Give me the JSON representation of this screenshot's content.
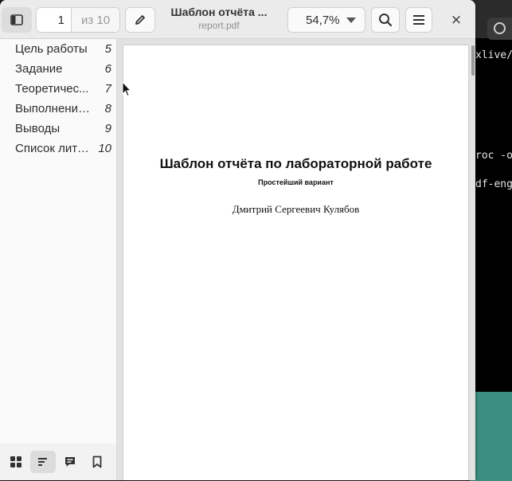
{
  "background_terminal": {
    "lines": [
      "xlive/",
      "roc -o",
      "df-eng"
    ]
  },
  "header": {
    "page_number": "1",
    "page_of": "из 10",
    "title": "Шаблон отчёта ...",
    "subtitle": "report.pdf",
    "zoom": "54,7%",
    "close_glyph": "×"
  },
  "sidebar": {
    "toc": [
      {
        "label": "Цель работы",
        "page": "5"
      },
      {
        "label": "Задание",
        "page": "6"
      },
      {
        "label": "Теоретичес...",
        "page": "7"
      },
      {
        "label": "Выполнение...",
        "page": "8"
      },
      {
        "label": "Выводы",
        "page": "9"
      },
      {
        "label": "Список лите...",
        "page": "10"
      }
    ],
    "tabs": [
      "thumbnails-icon",
      "outline-icon",
      "annotations-icon",
      "bookmarks-icon"
    ],
    "active_tab": "outline-icon"
  },
  "document": {
    "title": "Шаблон отчёта по лабораторной работе",
    "subtitle": "Простейший вариант",
    "author": "Дмитрий Сергеевич Кулябов"
  },
  "colors": {
    "header_bg": "#ebebeb",
    "sidebar_bg": "#fafafa",
    "doc_bg": "#e2e2e2",
    "desktop_accent": "#3c8f80"
  }
}
